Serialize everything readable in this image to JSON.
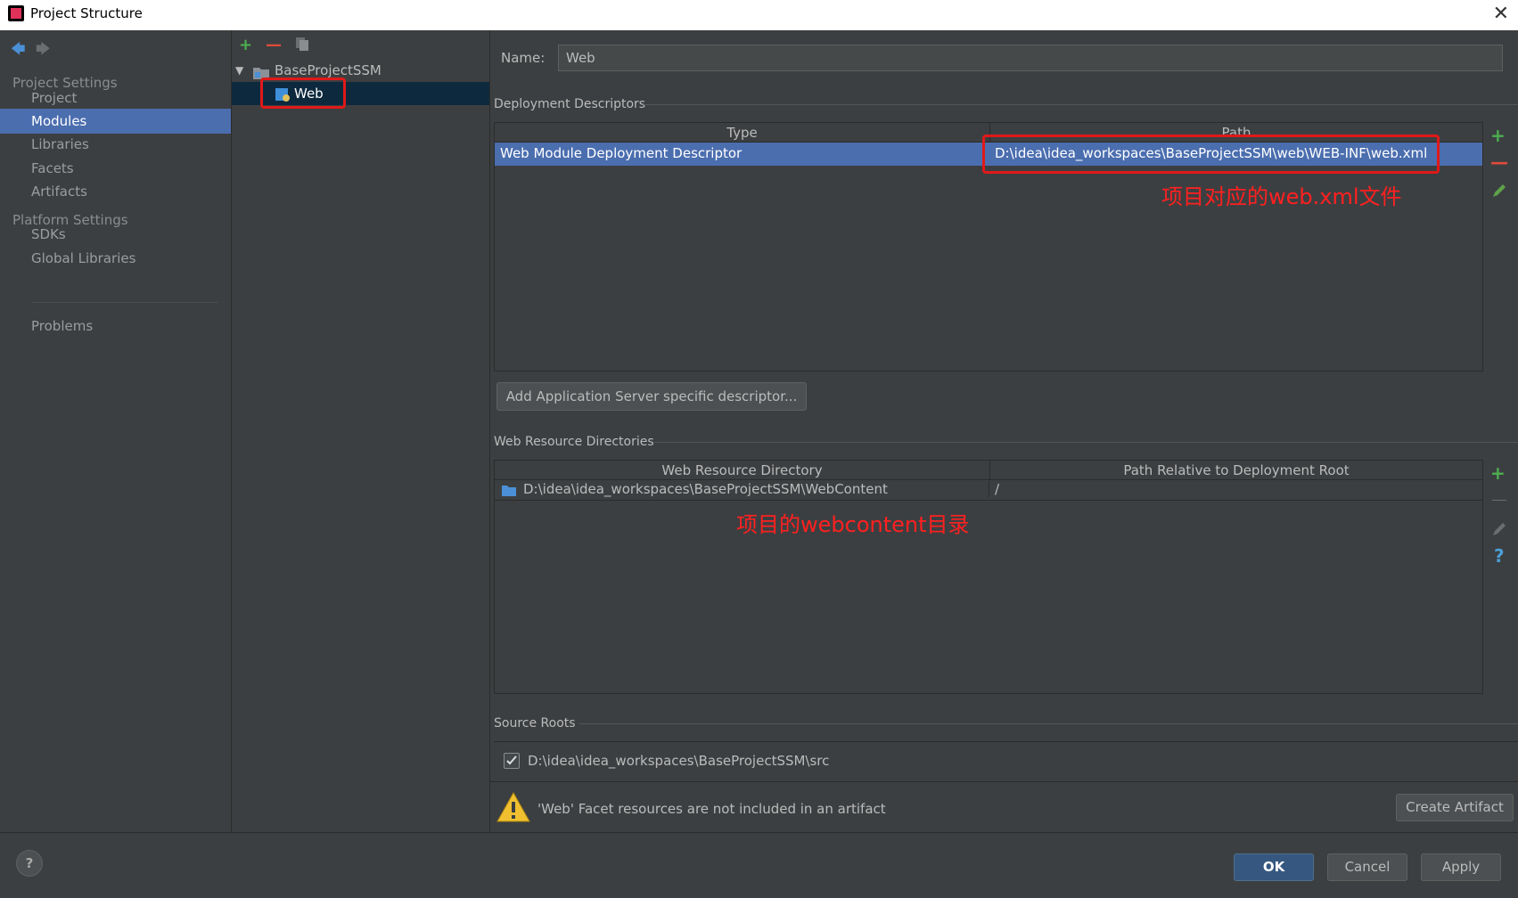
{
  "window": {
    "title": "Project Structure",
    "close_glyph": "✕"
  },
  "sidebar": {
    "project_settings_header": "Project Settings",
    "project_items": [
      "Project",
      "Modules",
      "Libraries",
      "Facets",
      "Artifacts"
    ],
    "platform_settings_header": "Platform Settings",
    "platform_items": [
      "SDKs",
      "Global Libraries"
    ],
    "problems_label": "Problems",
    "selected": "Modules"
  },
  "tree": {
    "root_label": "BaseProjectSSM",
    "child_label": "Web"
  },
  "main": {
    "name_label": "Name:",
    "name_value": "Web",
    "deployment_descriptors": {
      "title": "Deployment Descriptors",
      "columns": [
        "Type",
        "Path"
      ],
      "rows": [
        {
          "type": "Web Module Deployment Descriptor",
          "path": "D:\\idea\\idea_workspaces\\BaseProjectSSM\\web\\WEB-INF\\web.xml"
        }
      ],
      "add_button": "Add Application Server specific descriptor..."
    },
    "web_resource_directories": {
      "title": "Web Resource Directories",
      "columns": [
        "Web Resource Directory",
        "Path Relative to Deployment Root"
      ],
      "rows": [
        {
          "directory": "D:\\idea\\idea_workspaces\\BaseProjectSSM\\WebContent",
          "relative": "/"
        }
      ]
    },
    "source_roots": {
      "title": "Source Roots",
      "items": [
        {
          "path": "D:\\idea\\idea_workspaces\\BaseProjectSSM\\src",
          "checked": true
        }
      ]
    },
    "warning_text": "'Web' Facet resources are not included in an artifact",
    "create_artifact_button": "Create Artifact"
  },
  "annotations": {
    "webxml_note": "项目对应的web.xml文件",
    "webcontent_note": "项目的webcontent目录"
  },
  "footer": {
    "ok": "OK",
    "cancel": "Cancel",
    "apply": "Apply",
    "help_glyph": "?"
  },
  "colors": {
    "selection": "#4b6eaf",
    "annotation": "#ff2020",
    "add_icon": "#4caf50",
    "remove_icon": "#e04a3a",
    "background": "#3c3f41"
  }
}
